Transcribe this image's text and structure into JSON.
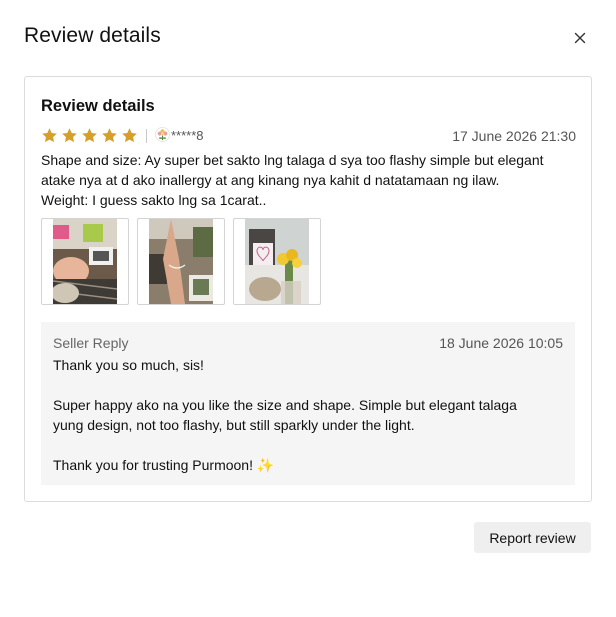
{
  "modal": {
    "title": "Review details",
    "close_icon": "close-icon"
  },
  "review": {
    "title": "Review details",
    "rating": 5,
    "max_rating": 5,
    "star_color": "#D4A02A",
    "username": "*****8",
    "date": "17 June 2026 21:30",
    "text_lines": [
      "Shape and size: Ay super bet sakto lng talaga d sya too flashy simple but elegant",
      "atake nya at d ako inallergy at ang kinang nya kahit d natatamaan ng ilaw.",
      "Weight: I guess sakto lng sa 1carat.."
    ],
    "photos": [
      "review-photo-1",
      "review-photo-2",
      "review-photo-3"
    ]
  },
  "seller_reply": {
    "label": "Seller Reply",
    "date": "18 June 2026 10:05",
    "line1": "Thank you so much, sis!",
    "line2": "Super happy ako na you like the size and shape. Simple but elegant talaga",
    "line3": "yung design, not too flashy, but still sparkly under the light.",
    "line4": "Thank you for trusting Purmoon! ✨"
  },
  "actions": {
    "report_label": "Report review"
  }
}
